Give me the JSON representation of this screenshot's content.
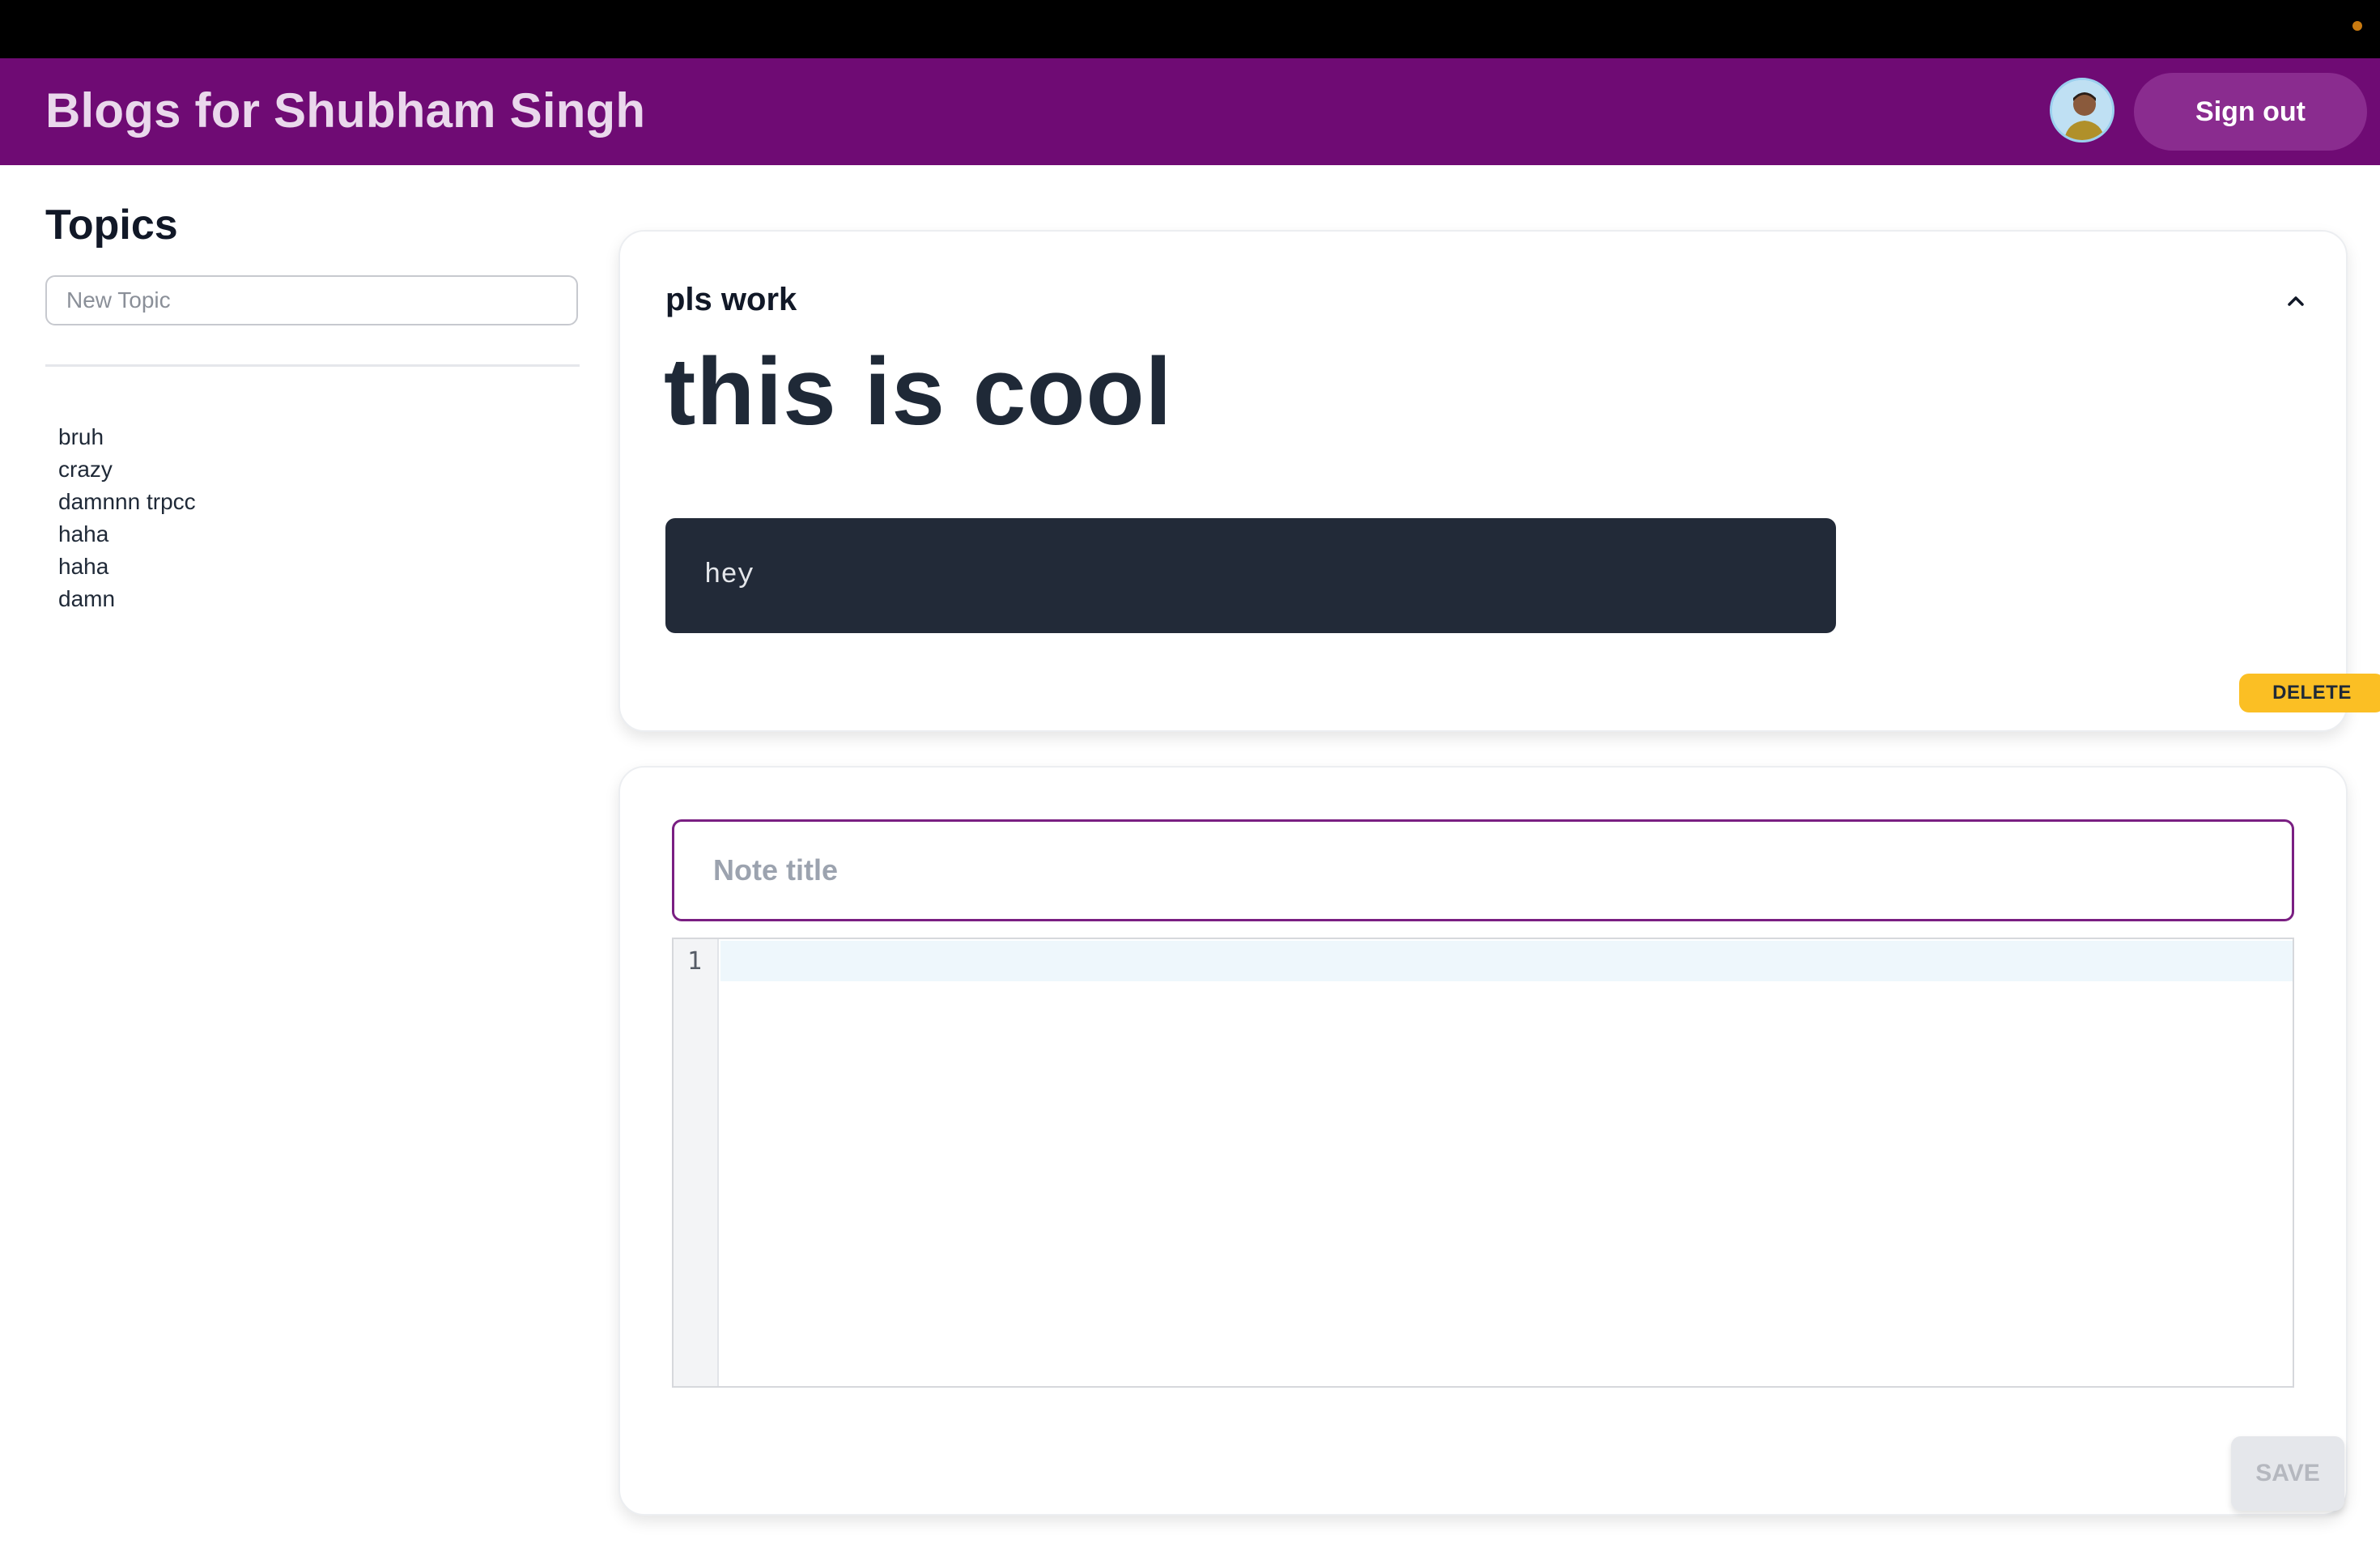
{
  "header": {
    "brand_title": "Blogs for Shubham Singh",
    "signout_label": "Sign out",
    "avatar_icon": "user-avatar-icon"
  },
  "sidebar": {
    "heading": "Topics",
    "new_topic_placeholder": "New Topic",
    "new_topic_value": "",
    "topics": [
      "bruh",
      "crazy",
      "damnnn trpcc",
      "haha",
      "haha",
      "damn"
    ]
  },
  "note": {
    "topic": "pls work",
    "title": "this is cool",
    "code": "hey",
    "delete_label": "DELETE",
    "collapse_icon": "chevron-up-icon"
  },
  "editor": {
    "title_placeholder": "Note title",
    "title_value": "",
    "line_number": "1",
    "save_label": "SAVE"
  },
  "colors": {
    "topbar": "#000000",
    "navbar": "#6f0b74",
    "signout_bg": "#8a2c8f",
    "code_block_bg": "#222a38",
    "delete_bg": "#fbbf24",
    "input_accent": "#7a1f82",
    "save_disabled_bg": "#e5e7eb"
  }
}
